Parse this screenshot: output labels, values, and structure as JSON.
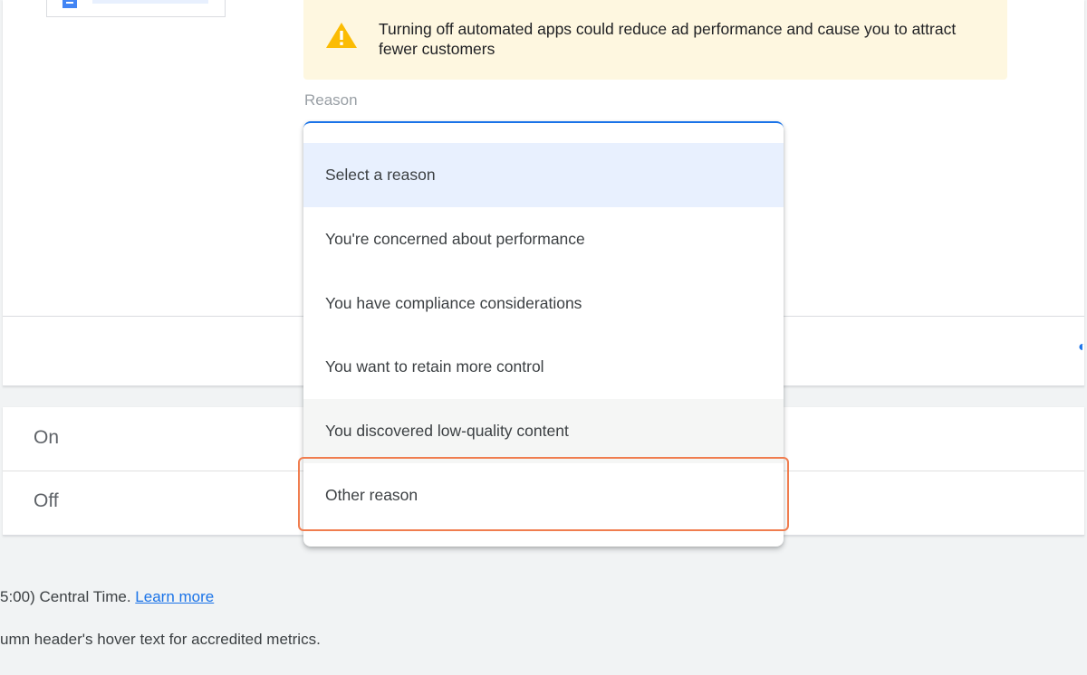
{
  "warning": {
    "text": "Turning off automated apps could reduce ad performance and cause you to attract fewer customers",
    "icon": "warning-icon",
    "color": "#fbbc04"
  },
  "reason_field": {
    "label": "Reason"
  },
  "dropdown": {
    "options": [
      "Select a reason",
      "You're concerned about performance",
      "You have compliance considerations",
      "You want to retain more control",
      "You discovered low-quality content",
      "Other reason"
    ],
    "selected_index": 0,
    "hovered_index": 4,
    "highlighted_index": 5
  },
  "settings_rows": {
    "on_label": "On",
    "off_label": "Off"
  },
  "footer": {
    "timezone_text": "5:00) Central Time.",
    "learn_more": "Learn more",
    "accredited_text": "umn header's hover text for accredited metrics."
  },
  "colors": {
    "accent": "#1a73e8",
    "warning_bg": "#fef7e0",
    "highlight": "#f07d4f",
    "selected_bg": "#e8f0fe"
  }
}
